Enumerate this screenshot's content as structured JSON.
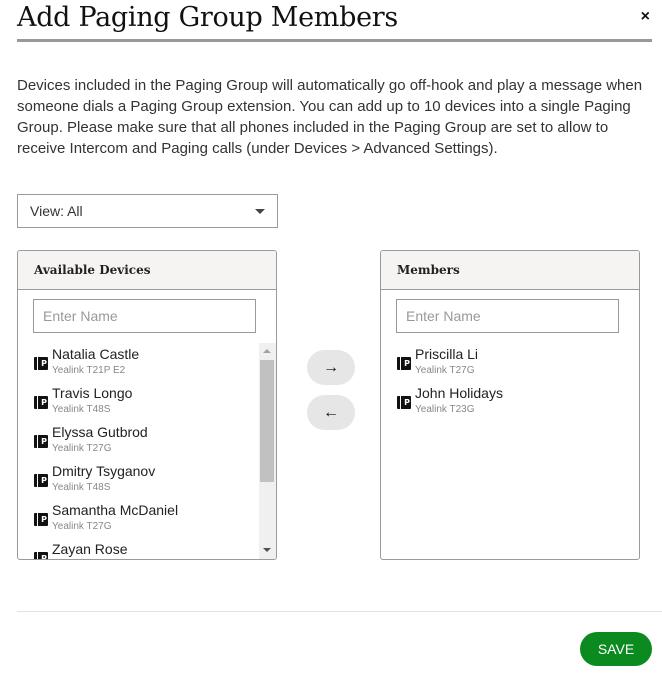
{
  "dialog": {
    "title": "Add Paging Group Members",
    "close_label": "×",
    "description": "Devices included in the Paging Group will automatically go off-hook and play a message when someone dials a Paging Group extension. You can add up to 10 devices into a single Paging Group. Please make sure that all phones included in the Paging Group are set to allow to receive Intercom and Paging calls (under Devices > Advanced Settings)."
  },
  "view_filter": {
    "selected": "View: All"
  },
  "available": {
    "header": "Available Devices",
    "search_placeholder": "Enter Name",
    "search_value": "",
    "items": [
      {
        "icon": "ip-phone-icon",
        "name": "Natalia Castle",
        "model": "Yealink T21P E2"
      },
      {
        "icon": "ip-phone-icon",
        "name": "Travis Longo",
        "model": "Yealink T48S"
      },
      {
        "icon": "ip-phone-icon",
        "name": "Elyssa Gutbrod",
        "model": "Yealink T27G"
      },
      {
        "icon": "ip-phone-icon",
        "name": "Dmitry Tsyganov",
        "model": "Yealink T48S"
      },
      {
        "icon": "ip-phone-icon",
        "name": "Samantha McDaniel",
        "model": "Yealink T27G"
      },
      {
        "icon": "ip-phone-icon",
        "name": "Zayan Rose",
        "model": ""
      }
    ]
  },
  "members": {
    "header": "Members",
    "search_placeholder": "Enter Name",
    "search_value": "",
    "items": [
      {
        "icon": "ip-phone-icon",
        "name": "Priscilla Li",
        "model": "Yealink T27G"
      },
      {
        "icon": "ip-phone-icon",
        "name": "John Holidays",
        "model": "Yealink T23G"
      }
    ]
  },
  "actions": {
    "add_icon": "→",
    "remove_icon": "←",
    "save_label": "SAVE"
  },
  "colors": {
    "save_green": "#0a8a1f",
    "panel_header_bg": "#f5f4f2"
  }
}
